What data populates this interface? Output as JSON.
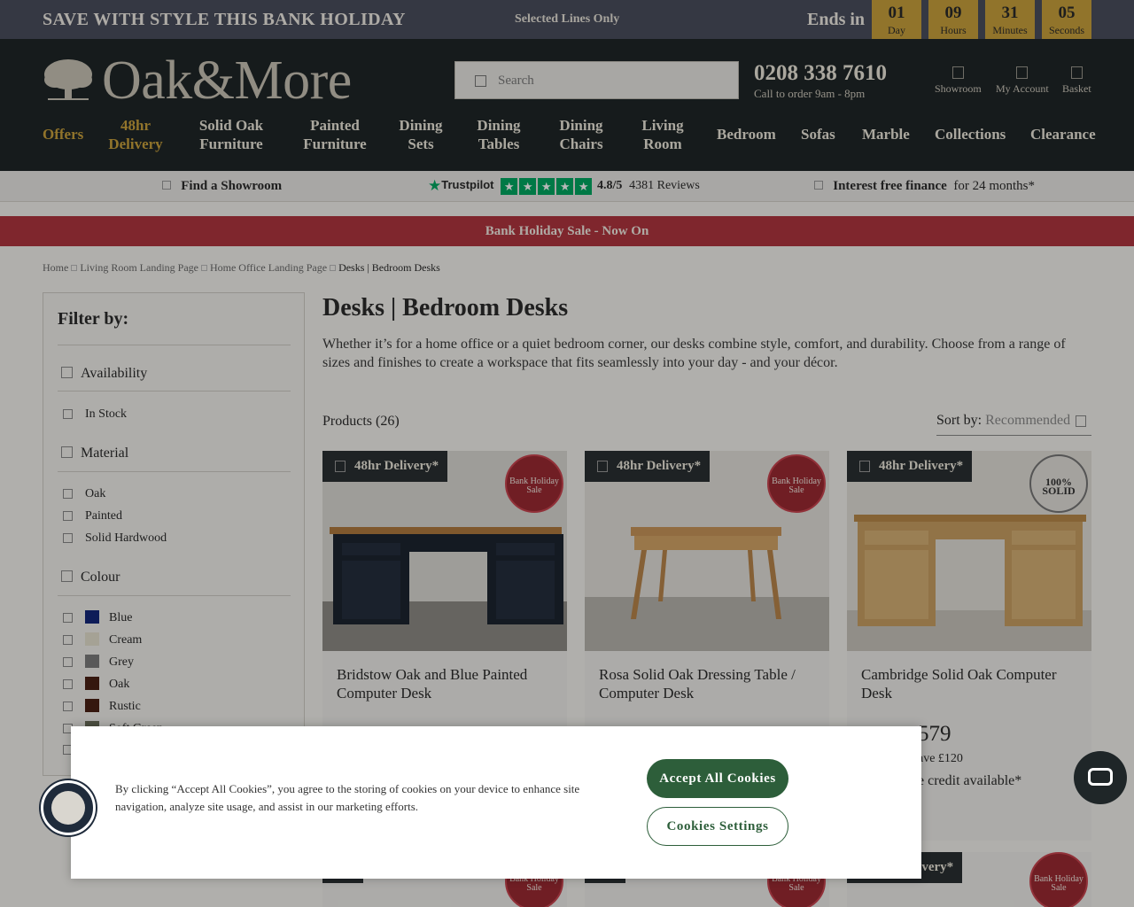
{
  "promo": {
    "headline": "SAVE WITH STYLE THIS BANK HOLIDAY",
    "subline": "Selected Lines Only",
    "ends_label": "Ends in",
    "countdown": [
      {
        "value": "01",
        "unit": "Day"
      },
      {
        "value": "09",
        "unit": "Hours"
      },
      {
        "value": "31",
        "unit": "Minutes"
      },
      {
        "value": "05",
        "unit": "Seconds"
      }
    ]
  },
  "header": {
    "brand": "Oak&More",
    "search_placeholder": "Search",
    "phone": "0208 338 7610",
    "call_hours": "Call to order 9am - 8pm",
    "icons": [
      {
        "label": "Showroom",
        "icon": "showroom-icon"
      },
      {
        "label": "My Account",
        "icon": "account-icon"
      },
      {
        "label": "Basket",
        "icon": "basket-icon"
      }
    ]
  },
  "nav": [
    {
      "label": "Offers",
      "highlight": true
    },
    {
      "label": "48hr Delivery",
      "highlight": true
    },
    {
      "label": "Solid Oak Furniture"
    },
    {
      "label": "Painted Furniture"
    },
    {
      "label": "Dining Sets"
    },
    {
      "label": "Dining Tables"
    },
    {
      "label": "Dining Chairs"
    },
    {
      "label": "Living Room"
    },
    {
      "label": "Bedroom"
    },
    {
      "label": "Sofas"
    },
    {
      "label": "Marble"
    },
    {
      "label": "Collections"
    },
    {
      "label": "Clearance"
    }
  ],
  "strip": {
    "showroom": "Find a Showroom",
    "trustpilot_brand": "Trustpilot",
    "rating": "4.8/5",
    "reviews": "4381 Reviews",
    "finance_bold": "Interest free finance",
    "finance_rest": "for 24 months*"
  },
  "sale_banner": "Bank Holiday Sale - Now On",
  "breadcrumb": [
    "Home",
    "Living Room Landing Page",
    "Home Office Landing Page",
    "Desks | Bedroom Desks"
  ],
  "filter": {
    "title": "Filter by:",
    "availability": {
      "label": "Availability",
      "options": [
        "In Stock"
      ]
    },
    "material": {
      "label": "Material",
      "options": [
        "Oak",
        "Painted",
        "Solid Hardwood"
      ]
    },
    "colour": {
      "label": "Colour",
      "options": [
        {
          "name": "Blue",
          "color": "#14287a"
        },
        {
          "name": "Cream",
          "color": "#e5e1cf"
        },
        {
          "name": "Grey",
          "color": "#7c7c7c"
        },
        {
          "name": "Oak",
          "color": "#4a2014"
        },
        {
          "name": "Rustic",
          "color": "#4a2014"
        },
        {
          "name": "Soft Green",
          "color": "#6b6f5a"
        }
      ]
    }
  },
  "page": {
    "title": "Desks | Bedroom Desks",
    "description": "Whether it’s for a home office or a quiet bedroom corner, our desks combine style, comfort, and durability. Choose from a range of sizes and finishes to create a workspace that fits seamlessly into your day - and your décor.",
    "products_count": "Products (26)",
    "sort_label": "Sort by:",
    "sort_value": "Recommended"
  },
  "products": [
    {
      "name": "Bridstow Oak and Blue Painted Computer Desk",
      "badge": "48hr Delivery*",
      "seal": "Bank Holiday Sale"
    },
    {
      "name": "Rosa Solid Oak Dressing Table / Computer Desk",
      "badge": "48hr Delivery*",
      "seal": "Bank Holiday Sale"
    },
    {
      "name": "Cambridge Solid Oak Computer Desk",
      "badge": "48hr Delivery*",
      "seal": "100% SOLID",
      "price": "579",
      "save": "ave £120",
      "credit": "e credit available*"
    }
  ],
  "second_row_badge_fragment": "livery*",
  "cookie": {
    "text": "By clicking “Accept All Cookies”, you agree to the storing of cookies on your device to enhance site navigation, analyze site usage, and assist in our marketing efforts.",
    "accept": "Accept All Cookies",
    "settings": "Cookies Settings"
  }
}
